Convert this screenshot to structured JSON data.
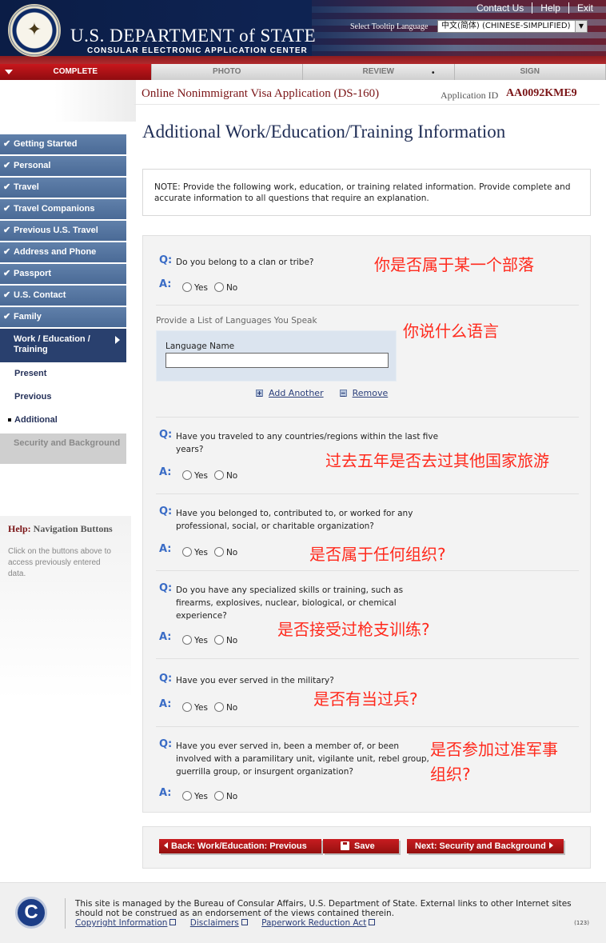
{
  "header": {
    "dept_title": "U.S. DEPARTMENT of STATE",
    "dept_subtitle": "CONSULAR ELECTRONIC APPLICATION CENTER",
    "links": [
      "Contact Us",
      "Help",
      "Exit"
    ],
    "tooltip_label": "Select Tooltip Language",
    "tooltip_value": "中文(简体) (CHINESE-SIMPLIFIED)"
  },
  "progress_tabs": [
    {
      "label": "COMPLETE",
      "active": true
    },
    {
      "label": "PHOTO",
      "active": false
    },
    {
      "label": "REVIEW",
      "active": false
    },
    {
      "label": "SIGN",
      "active": false
    }
  ],
  "application": {
    "title": "Online Nonimmigrant Visa Application (DS-160)",
    "id_label": "Application ID",
    "id_value": "AA0092KME9"
  },
  "page_title": "Additional Work/Education/Training Information",
  "sidebar": {
    "items": [
      "Getting Started",
      "Personal",
      "Travel",
      "Travel Companions",
      "Previous U.S. Travel",
      "Address and Phone",
      "Passport",
      "U.S. Contact",
      "Family"
    ],
    "active": "Work / Education / Training",
    "subitems": [
      "Present",
      "Previous",
      "Additional"
    ],
    "disabled": "Security and Background"
  },
  "help": {
    "title_prefix": "Help:",
    "title_rest": "Navigation Buttons",
    "text": "Click on the buttons above to access previously entered data."
  },
  "note": "NOTE: Provide the following work, education, or training related information. Provide complete and accurate information to all questions that require an explanation.",
  "labels": {
    "q": "Q:",
    "a": "A:",
    "yes": "Yes",
    "no": "No"
  },
  "questions": {
    "clan": "Do you belong to a clan or tribe?",
    "traveled": "Have you traveled to any countries/regions within the last five years?",
    "organization": "Have you belonged to, contributed to, or worked for any professional, social, or charitable organization?",
    "skills": "Do you have any specialized skills or training, such as firearms, explosives, nuclear, biological, or chemical experience?",
    "military": "Have you ever served in the military?",
    "paramilitary": "Have you ever served in, been a member of, or been involved with a paramilitary unit, vigilante unit, rebel group, guerrilla group, or insurgent organization?"
  },
  "languages": {
    "section_label": "Provide a List of Languages You Speak",
    "field_label": "Language Name",
    "field_value": "",
    "add_label": "Add Another",
    "remove_label": "Remove"
  },
  "annotations": {
    "clan": "你是否属于某一个部落",
    "language": "你说什么语言",
    "traveled": "过去五年是否去过其他国家旅游",
    "organization": "是否属于任何组织?",
    "skills": "是否接受过枪支训练?",
    "military": "是否有当过兵?",
    "paramilitary_line1": "是否参加过准军事",
    "paramilitary_line2": "组织?"
  },
  "buttons": {
    "back": "Back: Work/Education: Previous",
    "save": "Save",
    "next": "Next: Security and Background"
  },
  "footer": {
    "text": "This site is managed by the Bureau of Consular Affairs, U.S. Department of State. External links to other Internet sites should not be construed as an endorsement of the views contained therein.",
    "links": [
      "Copyright Information",
      "Disclaimers",
      "Paperwork Reduction Act"
    ],
    "code": "(123)"
  },
  "colors": {
    "accent_red": "#c71c20",
    "annotation_red": "#ff2a1d",
    "sidebar_blue": "#4a6a96",
    "qa_blue": "#3a6cc6"
  }
}
